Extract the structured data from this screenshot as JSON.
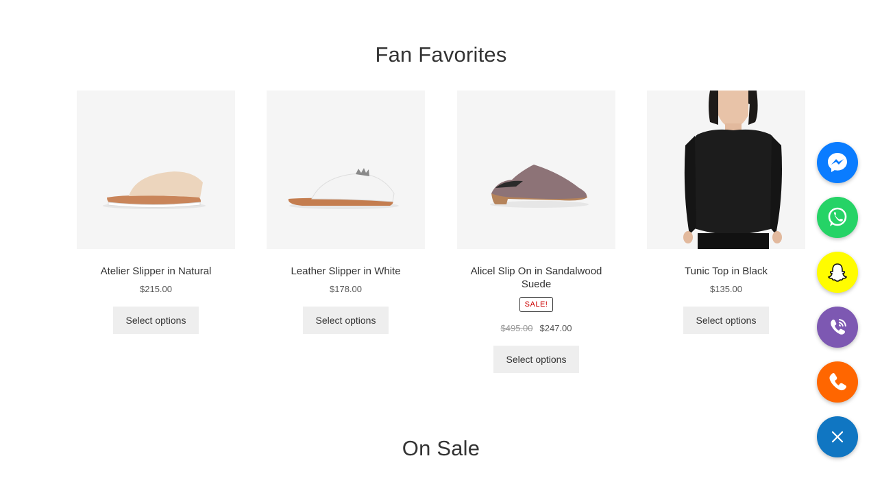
{
  "sections": {
    "fan_favorites": "Fan Favorites",
    "on_sale": "On Sale"
  },
  "products": [
    {
      "name": "Atelier Slipper in Natural",
      "price": "$215.00",
      "button": "Select options"
    },
    {
      "name": "Leather Slipper in White",
      "price": "$178.00",
      "button": "Select options"
    },
    {
      "name": "Alicel Slip On in Sandalwood Suede",
      "badge": "SALE!",
      "old_price": "$495.00",
      "price": "$247.00",
      "button": "Select options"
    },
    {
      "name": "Tunic Top in Black",
      "price": "$135.00",
      "button": "Select options"
    }
  ],
  "contact_buttons": [
    {
      "icon": "messenger-icon",
      "color": "#0A7CFF"
    },
    {
      "icon": "whatsapp-icon",
      "color": "#25D366"
    },
    {
      "icon": "snapchat-icon",
      "color": "#FFFC00"
    },
    {
      "icon": "viber-icon",
      "color": "#7D58B2"
    },
    {
      "icon": "phone-icon",
      "color": "#FF6600"
    },
    {
      "icon": "close-icon",
      "color": "#1076C2"
    }
  ]
}
